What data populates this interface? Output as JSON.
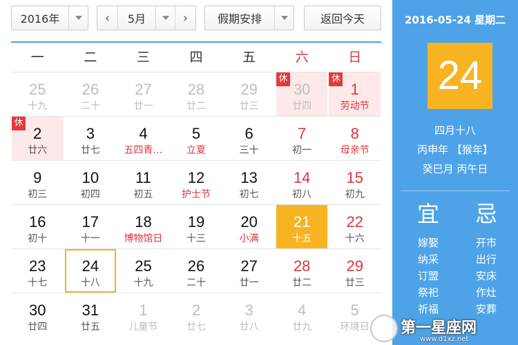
{
  "toolbar": {
    "year_label": "2016年",
    "month_label": "5月",
    "prev_icon": "‹",
    "next_icon": "›",
    "holiday_label": "假期安排",
    "today_label": "返回今天"
  },
  "weekdays": [
    "一",
    "二",
    "三",
    "四",
    "五",
    "六",
    "日"
  ],
  "weeks": [
    [
      {
        "day": "25",
        "lunar": "十九",
        "other": true
      },
      {
        "day": "26",
        "lunar": "二十",
        "other": true
      },
      {
        "day": "27",
        "lunar": "廿一",
        "other": true
      },
      {
        "day": "28",
        "lunar": "廿二",
        "other": true
      },
      {
        "day": "29",
        "lunar": "廿三",
        "other": true
      },
      {
        "day": "30",
        "lunar": "廿四",
        "other": true,
        "holiday": true,
        "badge": "休"
      },
      {
        "day": "1",
        "lunar": "劳动节",
        "fest": true,
        "holiday": true,
        "badge": "休"
      }
    ],
    [
      {
        "day": "2",
        "lunar": "廿六",
        "holiday": true,
        "badge": "休"
      },
      {
        "day": "3",
        "lunar": "廿七"
      },
      {
        "day": "4",
        "lunar": "五四青…",
        "fest": true
      },
      {
        "day": "5",
        "lunar": "立夏",
        "fest": true
      },
      {
        "day": "6",
        "lunar": "三十"
      },
      {
        "day": "7",
        "lunar": "初一"
      },
      {
        "day": "8",
        "lunar": "母亲节",
        "fest": true
      }
    ],
    [
      {
        "day": "9",
        "lunar": "初三"
      },
      {
        "day": "10",
        "lunar": "初四"
      },
      {
        "day": "11",
        "lunar": "初五"
      },
      {
        "day": "12",
        "lunar": "护士节",
        "fest": true
      },
      {
        "day": "13",
        "lunar": "初七"
      },
      {
        "day": "14",
        "lunar": "初八"
      },
      {
        "day": "15",
        "lunar": "初九"
      }
    ],
    [
      {
        "day": "16",
        "lunar": "初十"
      },
      {
        "day": "17",
        "lunar": "十一"
      },
      {
        "day": "18",
        "lunar": "博物馆日",
        "fest": true
      },
      {
        "day": "19",
        "lunar": "十三"
      },
      {
        "day": "20",
        "lunar": "小满",
        "fest": true
      },
      {
        "day": "21",
        "lunar": "十五",
        "selected": true
      },
      {
        "day": "22",
        "lunar": "十六"
      }
    ],
    [
      {
        "day": "23",
        "lunar": "十七"
      },
      {
        "day": "24",
        "lunar": "十八",
        "today": true
      },
      {
        "day": "25",
        "lunar": "十九"
      },
      {
        "day": "26",
        "lunar": "二十"
      },
      {
        "day": "27",
        "lunar": "廿一"
      },
      {
        "day": "28",
        "lunar": "廿二"
      },
      {
        "day": "29",
        "lunar": "廿三"
      }
    ],
    [
      {
        "day": "30",
        "lunar": "廿四"
      },
      {
        "day": "31",
        "lunar": "廿五"
      },
      {
        "day": "1",
        "lunar": "儿童节",
        "other": true
      },
      {
        "day": "2",
        "lunar": "廿七",
        "other": true
      },
      {
        "day": "3",
        "lunar": "廿八",
        "other": true
      },
      {
        "day": "4",
        "lunar": "廿九",
        "other": true
      },
      {
        "day": "5",
        "lunar": "环境日",
        "other": true
      }
    ]
  ],
  "panel": {
    "date_line": "2016-05-24 星期二",
    "big_day": "24",
    "lunar_date": "四月十八",
    "year_gz": "丙申年 【猴年】",
    "month_day_gz": "癸巳月 丙午日",
    "yi_head": "宜",
    "ji_head": "忌",
    "yi_items": [
      "嫁娶",
      "纳采",
      "订盟",
      "祭祀",
      "祈福"
    ],
    "ji_items": [
      "开市",
      "出行",
      "安床",
      "作灶",
      "安葬"
    ]
  },
  "watermark": {
    "text": "第一星座网",
    "url": "www.d1xz.net"
  },
  "colors": {
    "accent_blue": "#4ea3e8",
    "selected_orange": "#f7b322",
    "holiday_red": "#e4393c",
    "holiday_bg": "#fde9e9"
  }
}
